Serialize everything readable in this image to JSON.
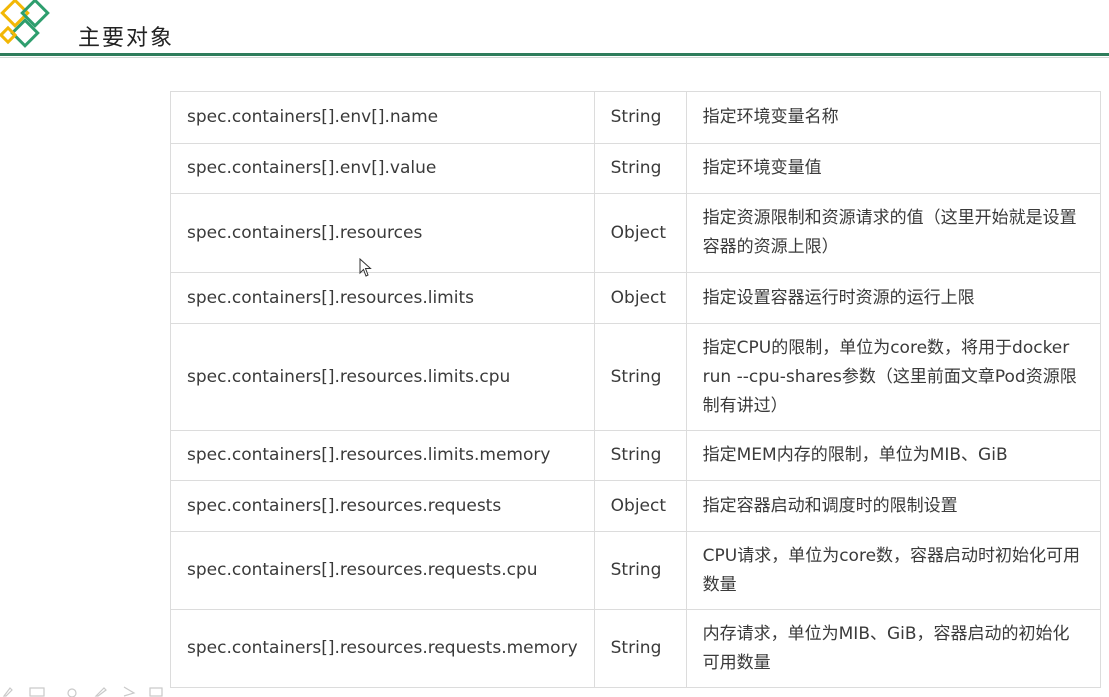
{
  "slide": {
    "title": "主要对象",
    "accent_color": "#2e7d5b",
    "logo_colors": [
      "#f2b705",
      "#2e9e6e"
    ]
  },
  "table": {
    "rows": [
      {
        "name": "spec.containers[].env[].name",
        "type": "String",
        "desc": "指定环境变量名称"
      },
      {
        "name": "spec.containers[].env[].value",
        "type": "String",
        "desc": "指定环境变量值"
      },
      {
        "name": "spec.containers[].resources",
        "type": "Object",
        "desc": "指定资源限制和资源请求的值（这里开始就是设置容器的资源上限）"
      },
      {
        "name": "spec.containers[].resources.limits",
        "type": "Object",
        "desc": "指定设置容器运行时资源的运行上限"
      },
      {
        "name": "spec.containers[].resources.limits.cpu",
        "type": "String",
        "desc": "指定CPU的限制，单位为core数，将用于docker run  --cpu-shares参数（这里前面文章Pod资源限制有讲过）"
      },
      {
        "name": "spec.containers[].resources.limits.memory",
        "type": "String",
        "desc": "指定MEM内存的限制，单位为MIB、GiB"
      },
      {
        "name": "spec.containers[].resources.requests",
        "type": "Object",
        "desc": "指定容器启动和调度时的限制设置"
      },
      {
        "name": "spec.containers[].resources.requests.cpu",
        "type": "String",
        "desc": "CPU请求，单位为core数，容器启动时初始化可用数量"
      },
      {
        "name": "spec.containers[].resources.requests.memory",
        "type": "String",
        "desc": "内存请求，单位为MIB、GiB，容器启动的初始化可用数量"
      }
    ]
  },
  "icons": {
    "logo": "diamond-logo-icon",
    "cursor": "mouse-pointer-icon",
    "toolbar": [
      "pen-icon",
      "slide-icon",
      "zoom-icon",
      "pencil-icon",
      "arrow-icon",
      "menu-icon"
    ]
  }
}
